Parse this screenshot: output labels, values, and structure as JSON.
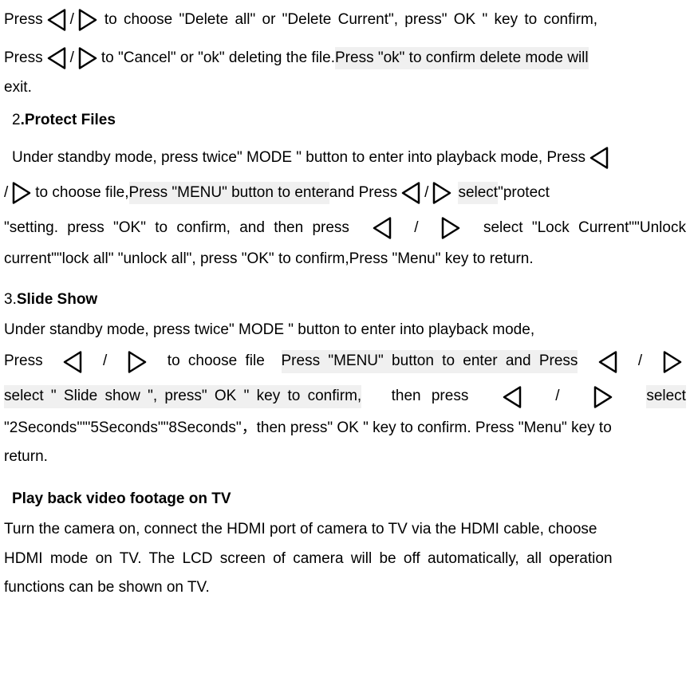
{
  "p1": {
    "seg1": "Press ",
    "seg2": " / ",
    "seg3": " to choose \"Delete all\" or \"Delete Current\", press\" OK \" key to confirm,"
  },
  "p2": {
    "seg1": "Press ",
    "seg2": " / ",
    "seg3": " to \"Cancel\" or \"ok\" deleting the file. ",
    "seg4": "Press \"ok\" to confirm delete mode will"
  },
  "p2b": "exit.",
  "h1_num": "2",
  "h1": ".Protect Files",
  "p3": {
    "seg1": "Under standby mode, press twice\" MODE \" button to enter into playback mode, Press "
  },
  "p4": {
    "seg1": "/ ",
    "seg2": " to choose file, ",
    "seg3": "Press \"MENU\" button to enter",
    "seg4": " and Press  ",
    "seg5": " / ",
    "seg6": " select",
    "seg7": " \"protect"
  },
  "p5": {
    "seg1": "\"setting. press \"OK\" to confirm, and then press",
    "seg2": " / ",
    "seg3": "select \"Lock Current\"\"Unlock"
  },
  "p6": "current\"\"lock all\" \"unlock all\", press \"OK\" to confirm,Press \"Menu\" key to return.",
  "h2_num": "3.",
  "h2": "Slide Show",
  "p7": "Under standby mode, press twice\" MODE \" button to enter into playback mode,",
  "p8": {
    "seg1": " Press ",
    "seg2": " / ",
    "seg3": " to choose file ",
    "seg4": "Press \"MENU\" button to enter and Press  ",
    "seg5": " / "
  },
  "p9": {
    "seg1": "select \"  Slide  show  \",  press\"   OK  \"  key  to  confirm, ",
    "seg2": " then  press",
    "seg3": " / ",
    "seg4": "  select"
  },
  "p10": "\"2Seconds'\"\"5Seconds\"\"8Seconds\"，then press\"   OK \" key to confirm. Press \"Menu\" key to",
  "p10b": "return.",
  "h3": "Play back video footage on TV",
  "p11": " Turn the camera on, connect the HDMI port of camera to TV via the HDMI cable, choose",
  "p12": "HDMI mode on TV. The LCD screen of camera will be off automatically, all operation",
  "p13": "functions can be shown on TV."
}
